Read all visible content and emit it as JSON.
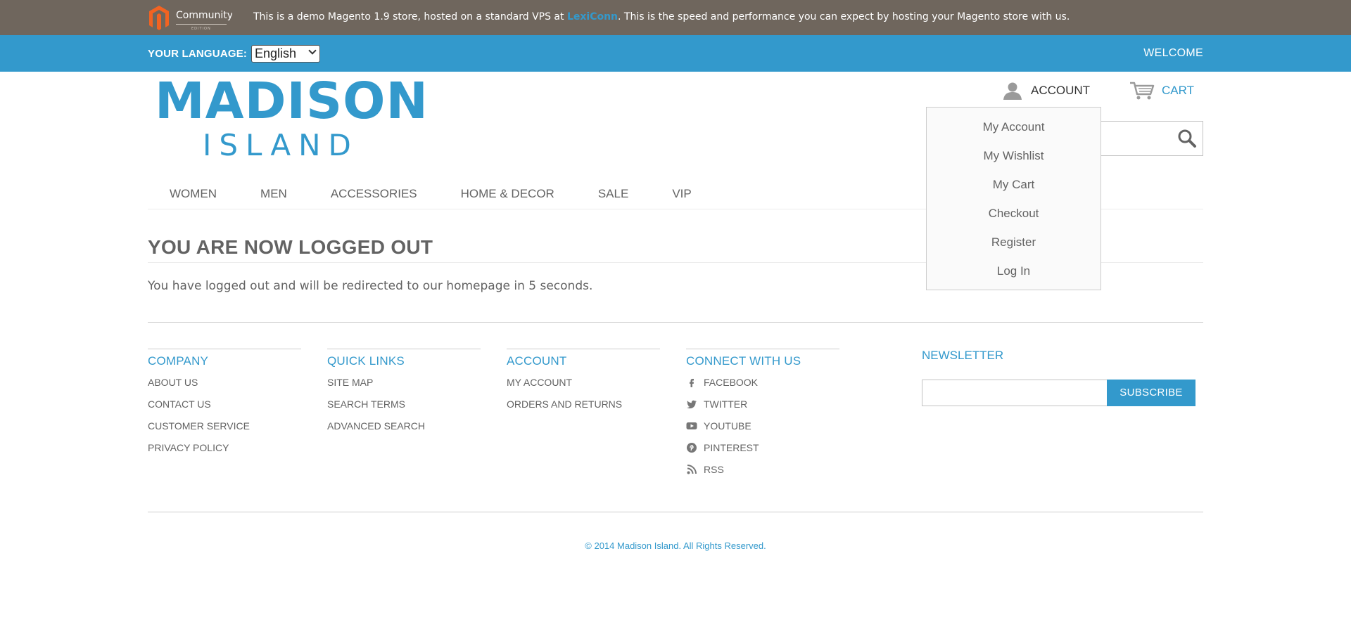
{
  "demo_bar": {
    "logo_text": "Community",
    "logo_subtext": "EDITION",
    "text_before": "This is a demo Magento 1.9 store, hosted on a standard VPS at ",
    "link_text": "LexiConn",
    "text_after": ". This is the speed and performance you can expect by hosting your Magento store with us."
  },
  "language_bar": {
    "label": "YOUR LANGUAGE:",
    "selected_language": "English",
    "welcome": "WELCOME"
  },
  "header": {
    "logo_main": "MADISON",
    "logo_sub": "ISLAND",
    "account_label": "ACCOUNT",
    "cart_label": "CART",
    "search_icon": "search-icon"
  },
  "account_dropdown": {
    "items": [
      "My Account",
      "My Wishlist",
      "My Cart",
      "Checkout",
      "Register",
      "Log In"
    ]
  },
  "nav": {
    "items": [
      "WOMEN",
      "MEN",
      "ACCESSORIES",
      "HOME & DECOR",
      "SALE",
      "VIP"
    ]
  },
  "main": {
    "title": "YOU ARE NOW LOGGED OUT",
    "message": "You have logged out and will be redirected to our homepage in 5 seconds."
  },
  "footer": {
    "company": {
      "heading": "COMPANY",
      "links": [
        "ABOUT US",
        "CONTACT US",
        "CUSTOMER SERVICE",
        "PRIVACY POLICY"
      ]
    },
    "quick_links": {
      "heading": "QUICK LINKS",
      "links": [
        "SITE MAP",
        "SEARCH TERMS",
        "ADVANCED SEARCH"
      ]
    },
    "account": {
      "heading": "ACCOUNT",
      "links": [
        "MY ACCOUNT",
        "ORDERS AND RETURNS"
      ]
    },
    "connect": {
      "heading": "CONNECT WITH US",
      "links": [
        {
          "label": "FACEBOOK",
          "icon": "facebook-icon"
        },
        {
          "label": "TWITTER",
          "icon": "twitter-icon"
        },
        {
          "label": "YOUTUBE",
          "icon": "youtube-icon"
        },
        {
          "label": "PINTEREST",
          "icon": "pinterest-icon"
        },
        {
          "label": "RSS",
          "icon": "rss-icon"
        }
      ]
    },
    "newsletter": {
      "heading": "NEWSLETTER",
      "input_value": "",
      "button_label": "SUBSCRIBE"
    },
    "copyright": "© 2014 Madison Island. All Rights Reserved."
  },
  "colors": {
    "accent": "#3399cc",
    "demo_bar": "#6f665d",
    "text": "#636363"
  }
}
